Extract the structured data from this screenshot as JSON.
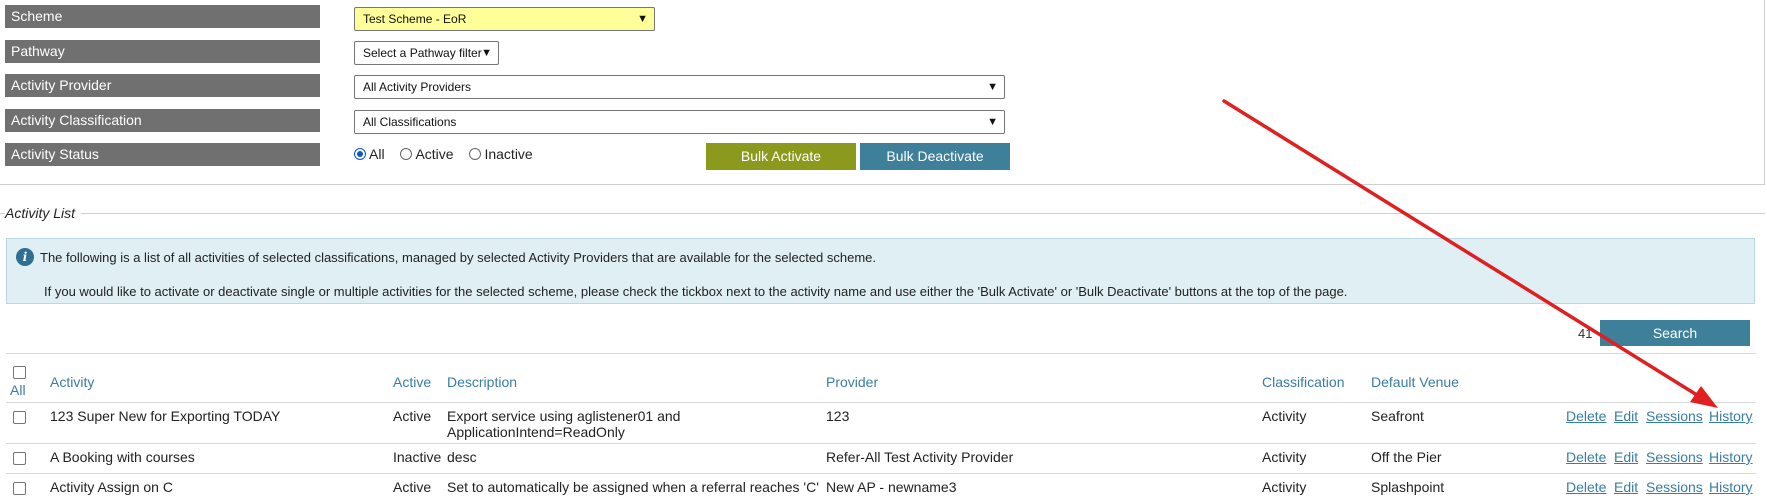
{
  "filters": {
    "scheme": {
      "label": "Scheme",
      "value": "Test Scheme - EoR"
    },
    "pathway": {
      "label": "Pathway",
      "value": "Select a Pathway filter"
    },
    "provider": {
      "label": "Activity Provider",
      "value": "All Activity Providers"
    },
    "classification": {
      "label": "Activity Classification",
      "value": "All Classifications"
    },
    "status": {
      "label": "Activity Status",
      "options": [
        "All",
        "Active",
        "Inactive"
      ],
      "selected": "All"
    },
    "bulk_activate": "Bulk Activate",
    "bulk_deactivate": "Bulk Deactivate"
  },
  "activity_list": {
    "legend": "Activity List",
    "info_line1": "The following is a list of all activities of selected classifications, managed by selected Activity Providers that are available for the selected scheme.",
    "info_line2": "If you would like to activate or deactivate single or multiple activities for the selected scheme, please check the tickbox next to the activity name and use either the 'Bulk Activate' or 'Bulk Deactivate' buttons at the top of the page.",
    "count": "41",
    "search_label": "Search",
    "columns": {
      "all": "All",
      "activity": "Activity",
      "active": "Active",
      "description": "Description",
      "provider": "Provider",
      "classification": "Classification",
      "venue": "Default Venue"
    },
    "row_actions": [
      "Delete",
      "Edit",
      "Sessions",
      "History"
    ],
    "rows": [
      {
        "activity": "123 Super New for Exporting TODAY",
        "active": "Active",
        "description_1": "Export service using aglistener01 and",
        "description_2": "ApplicationIntend=ReadOnly",
        "provider": "123",
        "classification": "Activity",
        "venue": "Seafront"
      },
      {
        "activity": "A Booking with courses",
        "active": "Inactive",
        "description_1": "desc",
        "provider": "Refer-All Test Activity Provider",
        "classification": "Activity",
        "venue": "Off the Pier"
      },
      {
        "activity": "Activity Assign on C",
        "active": "Active",
        "description_1": "Set to automatically be assigned when a referral reaches 'C'",
        "provider": "New AP - newname3",
        "classification": "Activity",
        "venue": "Splashpoint"
      }
    ]
  },
  "colors": {
    "label_bg": "#707070",
    "scheme_bg": "#ffff99",
    "activate_btn": "#8b9a1c",
    "teal_btn": "#3e7f99",
    "link": "#3a7da3",
    "info_bg": "#e0eff3",
    "annotation_arrow": "#e02020"
  }
}
